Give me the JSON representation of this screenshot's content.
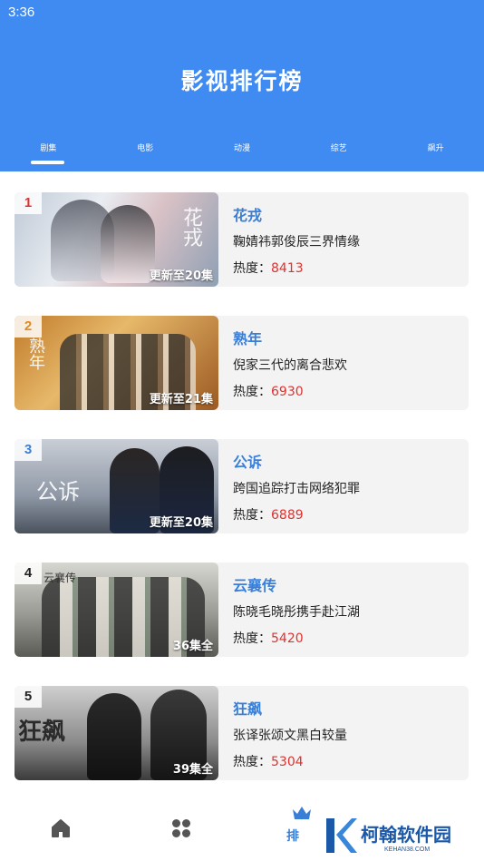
{
  "status_bar": {
    "time": "3:36"
  },
  "header": {
    "title": "影视排行榜"
  },
  "tabs": [
    {
      "label": "剧集",
      "active": true
    },
    {
      "label": "电影",
      "active": false
    },
    {
      "label": "动漫",
      "active": false
    },
    {
      "label": "综艺",
      "active": false
    },
    {
      "label": "飙升",
      "active": false
    }
  ],
  "heat_label": "热度：",
  "items": [
    {
      "rank": "1",
      "rank_color": "#e0312e",
      "name": "花戎",
      "desc": "鞠婧祎郭俊辰三界情缘",
      "heat": "8413",
      "episodes": "更新至20集",
      "poster_art": "花戎"
    },
    {
      "rank": "2",
      "rank_color": "#e08a1e",
      "name": "熟年",
      "desc": "倪家三代的离合悲欢",
      "heat": "6930",
      "episodes": "更新至21集",
      "poster_art": "熟年"
    },
    {
      "rank": "3",
      "rank_color": "#3a7fd7",
      "name": "公诉",
      "desc": "跨国追踪打击网络犯罪",
      "heat": "6889",
      "episodes": "更新至20集",
      "poster_art": "公诉"
    },
    {
      "rank": "4",
      "rank_color": "#222222",
      "name": "云襄传",
      "desc": "陈晓毛晓彤携手赴江湖",
      "heat": "5420",
      "episodes": "36集全",
      "poster_art": "云襄传"
    },
    {
      "rank": "5",
      "rank_color": "#222222",
      "name": "狂飙",
      "desc": "张译张颂文黑白较量",
      "heat": "5304",
      "episodes": "39集全",
      "poster_art": "狂飙"
    }
  ],
  "bottom_nav": {
    "rank_label": "排"
  },
  "watermark": {
    "name": "柯翰软件园",
    "url": "KEHAN38.COM"
  },
  "colors": {
    "header": "#3f8bf1",
    "accent": "#3a7fd7",
    "heat": "#e0312e"
  }
}
